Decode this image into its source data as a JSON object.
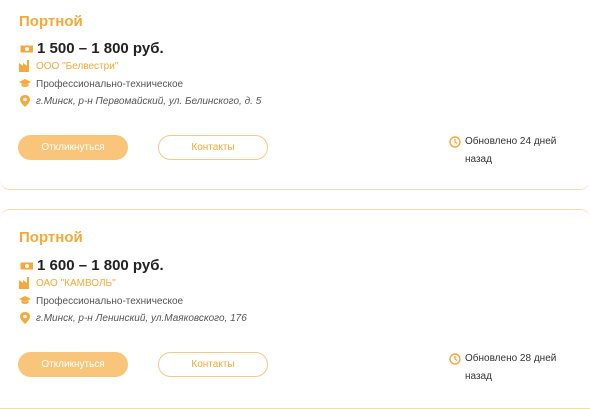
{
  "vacancies": [
    {
      "title": "Портной",
      "salary": "1 500 – 1 800 руб.",
      "company": "ООО \"Белвестри\"",
      "education": "Профессионально-техническое",
      "address": "г.Минск, р-н Первомайский, ул. Белинского, д. 5",
      "apply_label": "Откликнуться",
      "contacts_label": "Контакты",
      "updated": "Обновлено 24 дней назад"
    },
    {
      "title": "Портной",
      "salary": "1 600 – 1 800 руб.",
      "company": "ОАО \"КАМВОЛЬ\"",
      "education": "Профессионально-техническое",
      "address": "г.Минск, р-н Ленинский, ул.Маяковского, 176",
      "apply_label": "Откликнуться",
      "contacts_label": "Контакты",
      "updated": "Обновлено 28 дней назад"
    }
  ],
  "colors": {
    "accent": "#f4a93a",
    "button_fill": "#f8c57a",
    "border": "#f1dcb1"
  },
  "icons": [
    "money-icon",
    "factory-icon",
    "graduation-cap-icon",
    "location-pin-icon",
    "clock-icon"
  ]
}
